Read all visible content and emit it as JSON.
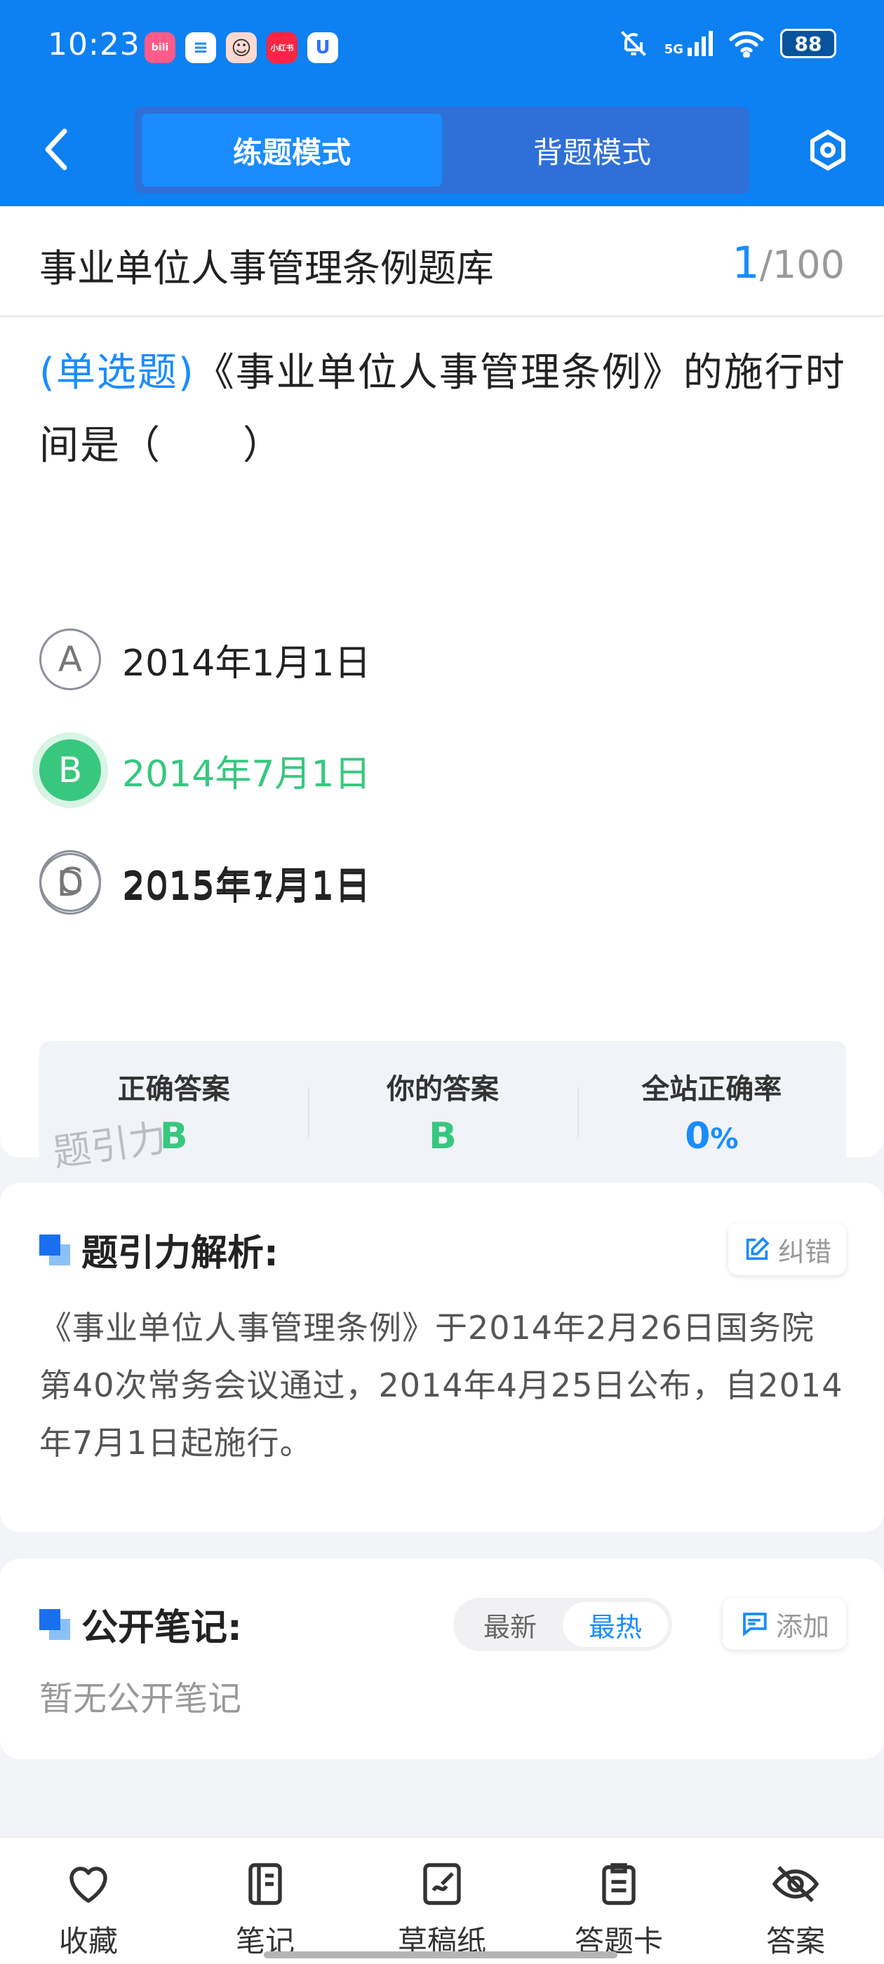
{
  "status_bar": {
    "time": "10:23",
    "app_icons": [
      {
        "name": "bilibili-icon",
        "color": "#ff5c8a",
        "text": "bili"
      },
      {
        "name": "message-app-icon",
        "color": "#1a8cff",
        "text": "≡"
      },
      {
        "name": "avatar-app-icon",
        "color": "#ffd9d0",
        "text": "☺"
      },
      {
        "name": "xiaohongshu-icon",
        "color": "#ff2442",
        "text": "小红书"
      },
      {
        "name": "u-app-icon",
        "color": "#2f6fff",
        "text": "U"
      }
    ],
    "network": "5G",
    "battery": "88"
  },
  "header": {
    "tabs": [
      {
        "label": "练题模式",
        "active": true
      },
      {
        "label": "背题模式",
        "active": false
      }
    ]
  },
  "question_bank": {
    "title": "事业单位人事管理条例题库",
    "current": "1",
    "total": "/100"
  },
  "question": {
    "type": "(单选题)",
    "text": "《事业单位人事管理条例》的施行时间是（　　）",
    "options": [
      {
        "letter": "A",
        "text": "2014年1月1日"
      },
      {
        "letter": "B",
        "text": "2014年7月1日"
      },
      {
        "letter": "C",
        "text": "2015年1月1日"
      },
      {
        "letter": "D",
        "text": "2015年7月1日"
      }
    ]
  },
  "answer_summary": {
    "correct_label": "正确答案",
    "correct_value": "B",
    "yours_label": "你的答案",
    "yours_value": "B",
    "rate_label": "全站正确率",
    "rate_value": "0",
    "rate_unit": "%",
    "watermark": "题引力"
  },
  "analysis": {
    "title": "题引力解析:",
    "correct_button": "纠错",
    "text": "《事业单位人事管理条例》于2014年2月26日国务院第40次常务会议通过，2014年4月25日公布，自2014年7月1日起施行。"
  },
  "notes": {
    "title": "公开笔记:",
    "sort_options": [
      "最新",
      "最热"
    ],
    "add_button": "添加",
    "empty_text": "暂无公开笔记"
  },
  "bottom_nav": [
    {
      "label": "收藏",
      "icon": "heart-icon"
    },
    {
      "label": "笔记",
      "icon": "notebook-icon"
    },
    {
      "label": "草稿纸",
      "icon": "draft-paper-icon"
    },
    {
      "label": "答题卡",
      "icon": "answer-card-icon"
    },
    {
      "label": "答案",
      "icon": "eye-off-icon"
    }
  ],
  "colors": {
    "primary": "#0d80f2",
    "accent": "#1a8cff",
    "correct": "#38c77e"
  }
}
